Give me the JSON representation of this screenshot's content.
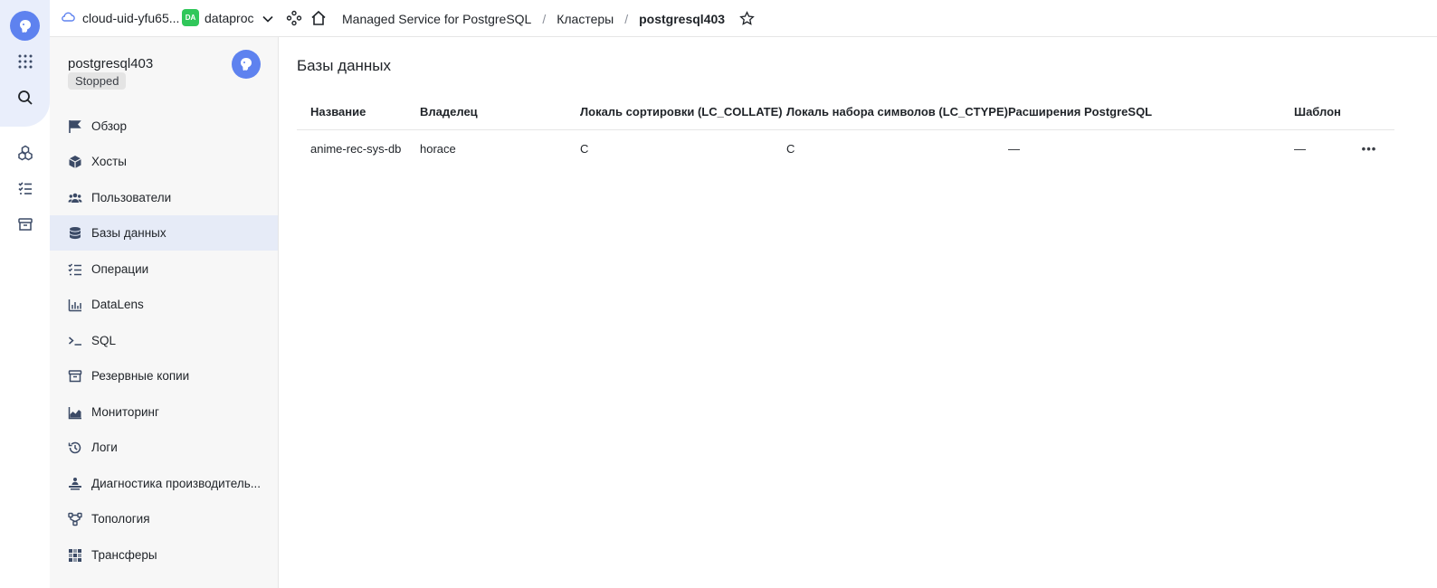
{
  "topbar": {
    "cloud_label": "cloud-uid-yfu65...",
    "folder_badge": "DA",
    "folder_label": "dataproc",
    "breadcrumbs": [
      "Managed Service for PostgreSQL",
      "Кластеры",
      "postgresql403"
    ],
    "separator": "/"
  },
  "sidebar": {
    "cluster_name": "postgresql403",
    "status": "Stopped",
    "items": [
      {
        "label": "Обзор",
        "icon": "flag-icon"
      },
      {
        "label": "Хосты",
        "icon": "cube-icon"
      },
      {
        "label": "Пользователи",
        "icon": "users-icon"
      },
      {
        "label": "Базы данных",
        "icon": "database-icon"
      },
      {
        "label": "Операции",
        "icon": "list-check-icon"
      },
      {
        "label": "DataLens",
        "icon": "chart-bars-icon"
      },
      {
        "label": "SQL",
        "icon": "terminal-icon"
      },
      {
        "label": "Резервные копии",
        "icon": "archive-icon"
      },
      {
        "label": "Мониторинг",
        "icon": "area-chart-icon"
      },
      {
        "label": "Логи",
        "icon": "history-icon"
      },
      {
        "label": "Диагностика производитель...",
        "icon": "diagnostics-icon"
      },
      {
        "label": "Топология",
        "icon": "topology-icon"
      },
      {
        "label": "Трансферы",
        "icon": "transfers-icon"
      }
    ],
    "active_index": 3
  },
  "main": {
    "title": "Базы данных",
    "columns": [
      "Название",
      "Владелец",
      "Локаль сортировки (LC_COLLATE)",
      "Локаль набора символов (LC_CTYPE)",
      "Расширения PostgreSQL",
      "Шаблон"
    ],
    "rows": [
      {
        "name": "anime-rec-sys-db",
        "owner": "horace",
        "collate": "C",
        "ctype": "C",
        "extensions": "—",
        "template": "—"
      }
    ],
    "row_menu": "•••"
  },
  "colors": {
    "accent": "#5e82ef",
    "active_item_bg": "#e6ebf7",
    "folder_badge_bg": "#30c75a",
    "sidebar_bg": "#f7f7f7"
  }
}
